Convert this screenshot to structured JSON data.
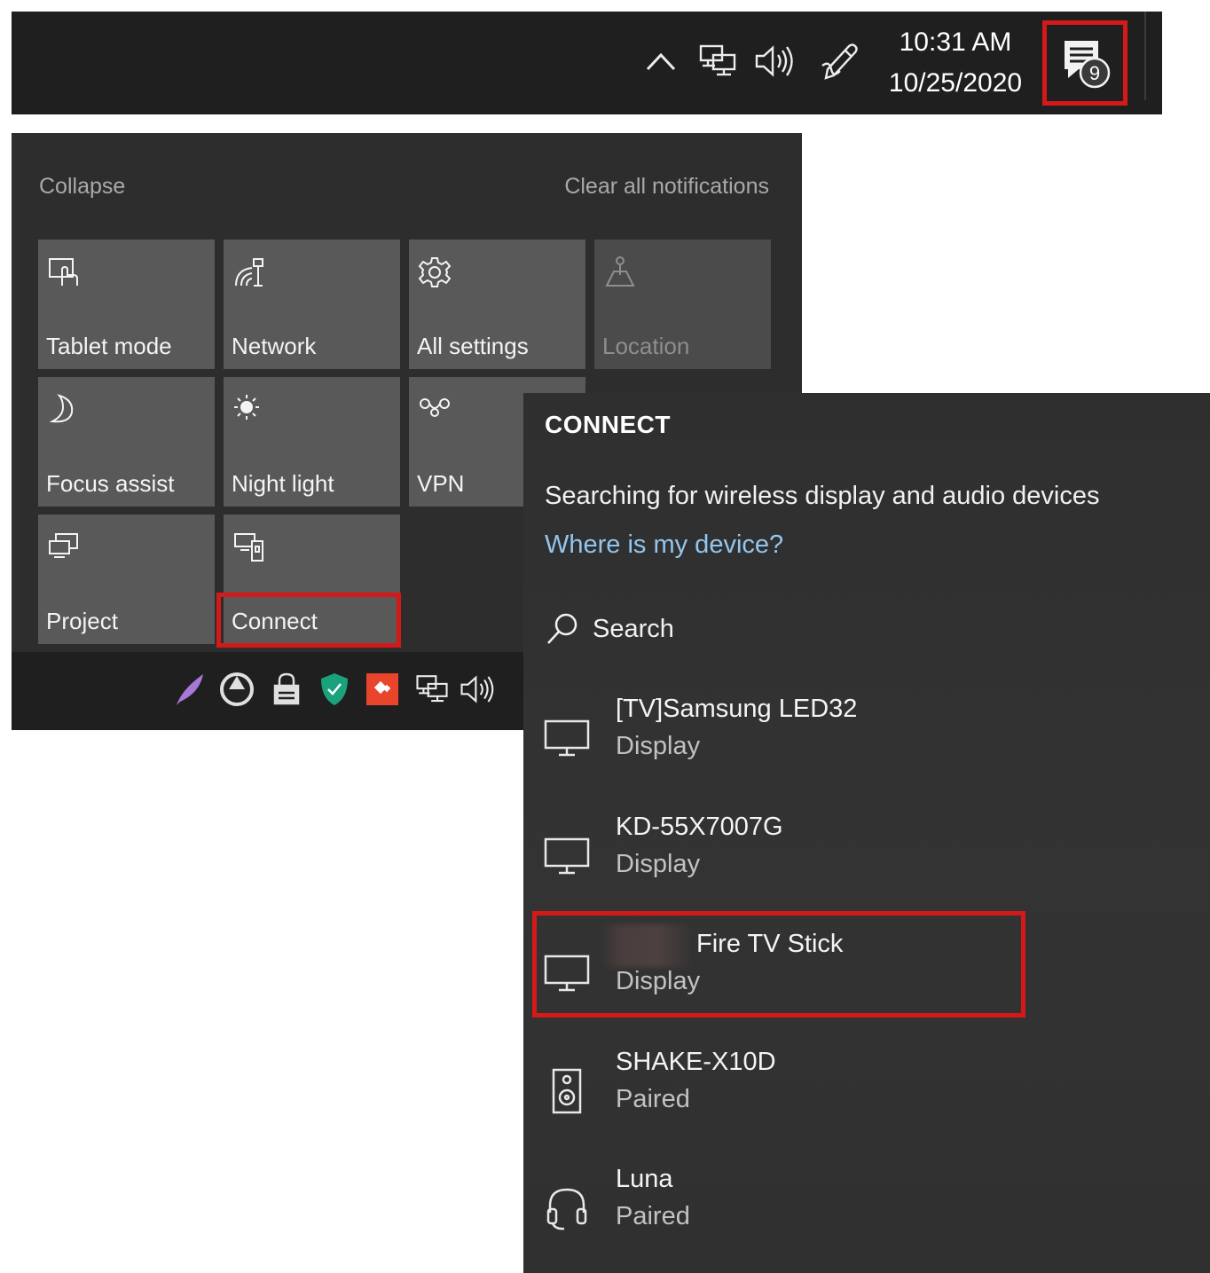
{
  "taskbar": {
    "time": "10:31 AM",
    "date": "10/25/2020",
    "notification_count": "9",
    "icons": [
      "chevron-up-icon",
      "network-icon",
      "volume-icon",
      "pen-icon",
      "action-center-icon"
    ]
  },
  "action_center": {
    "collapse_label": "Collapse",
    "clear_label": "Clear all notifications",
    "tiles": [
      {
        "label": "Tablet mode",
        "icon": "tablet-mode-icon",
        "active": true
      },
      {
        "label": "Network",
        "icon": "network-wifi-icon",
        "active": true
      },
      {
        "label": "All settings",
        "icon": "gear-icon",
        "active": true
      },
      {
        "label": "Location",
        "icon": "location-icon",
        "active": false
      },
      {
        "label": "Focus assist",
        "icon": "moon-icon",
        "active": true
      },
      {
        "label": "Night light",
        "icon": "sun-icon",
        "active": true
      },
      {
        "label": "VPN",
        "icon": "vpn-icon",
        "active": true
      },
      {
        "label": "Project",
        "icon": "project-icon",
        "active": true
      },
      {
        "label": "Connect",
        "icon": "connect-icon",
        "active": true
      }
    ],
    "tray_icons": [
      "feather-icon",
      "recycle-icon",
      "lock-icon",
      "shield-icon",
      "anydesk-icon",
      "network-icon",
      "volume-icon"
    ]
  },
  "connect_panel": {
    "title": "CONNECT",
    "status": "Searching for wireless display and audio devices",
    "help_link": "Where is my device?",
    "search_label": "Search",
    "devices": [
      {
        "name": "[TV]Samsung LED32",
        "subtitle": "Display",
        "icon": "monitor-icon"
      },
      {
        "name": "KD-55X7007G",
        "subtitle": "Display",
        "icon": "monitor-icon"
      },
      {
        "name": "Fire TV Stick",
        "subtitle": "Display",
        "icon": "monitor-icon"
      },
      {
        "name": "SHAKE-X10D",
        "subtitle": "Paired",
        "icon": "speaker-icon"
      },
      {
        "name": "Luna",
        "subtitle": "Paired",
        "icon": "headset-icon"
      }
    ]
  },
  "colors": {
    "highlight": "#d51919",
    "link": "#92c6ee",
    "tile_active": "#595959",
    "tile_inactive": "#4b4b4b",
    "panel_bg": "#313131",
    "taskbar_bg": "#1f1f1f"
  }
}
